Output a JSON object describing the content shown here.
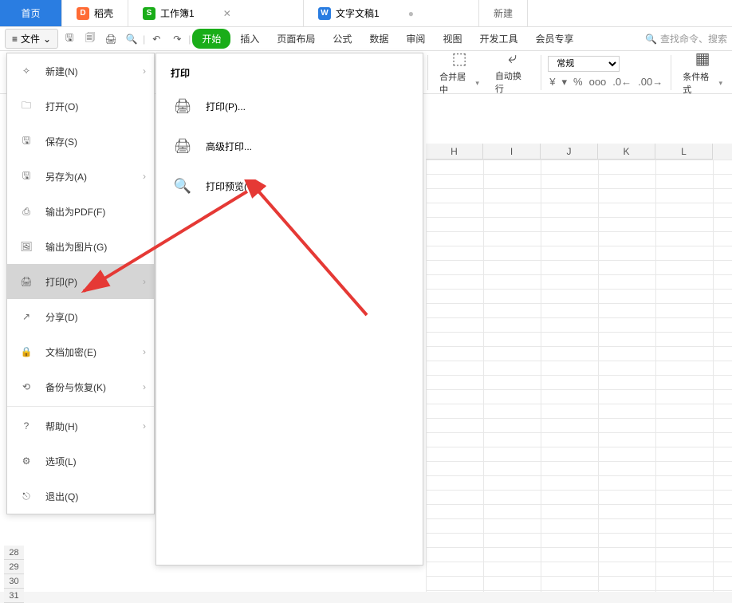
{
  "tabs": {
    "home": "首页",
    "daoke": "稻壳",
    "workbook": "工作簿1",
    "doc": "文字文稿1",
    "new": "新建"
  },
  "toolbar": {
    "file": "文件",
    "search_placeholder": "查找命令、搜索"
  },
  "ribbon_tabs": [
    "开始",
    "插入",
    "页面布局",
    "公式",
    "数据",
    "审阅",
    "视图",
    "开发工具",
    "会员专享"
  ],
  "ribbon": {
    "merge": "合并居中",
    "autowrap": "自动换行",
    "general": "常规",
    "currency_sym": "¥",
    "condfmt": "条件格式"
  },
  "file_menu": [
    {
      "label": "新建(N)",
      "arrow": true
    },
    {
      "label": "打开(O)",
      "arrow": false
    },
    {
      "label": "保存(S)",
      "arrow": false
    },
    {
      "label": "另存为(A)",
      "arrow": true
    },
    {
      "label": "输出为PDF(F)",
      "arrow": false
    },
    {
      "label": "输出为图片(G)",
      "arrow": false
    },
    {
      "label": "打印(P)",
      "arrow": true,
      "active": true
    },
    {
      "label": "分享(D)",
      "arrow": false
    },
    {
      "label": "文档加密(E)",
      "arrow": true
    },
    {
      "label": "备份与恢复(K)",
      "arrow": true
    },
    {
      "label": "帮助(H)",
      "arrow": true
    },
    {
      "label": "选项(L)",
      "arrow": false
    },
    {
      "label": "退出(Q)",
      "arrow": false
    }
  ],
  "print_submenu": {
    "title": "打印",
    "items": [
      "打印(P)...",
      "高级打印...",
      "打印预览(V)"
    ]
  },
  "columns": [
    "H",
    "I",
    "J",
    "K",
    "L"
  ],
  "rows": [
    28,
    29,
    30,
    31
  ]
}
